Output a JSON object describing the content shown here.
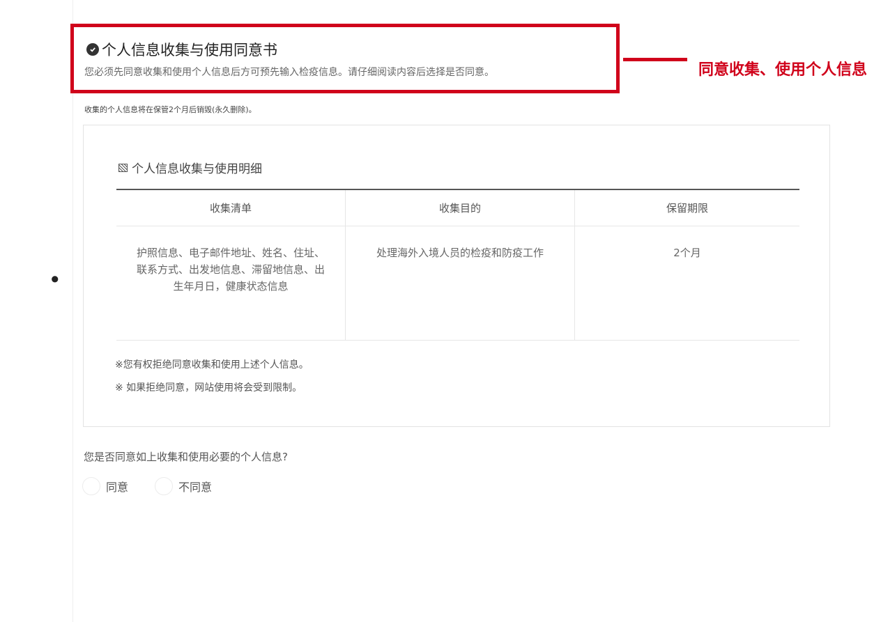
{
  "header": {
    "title": "个人信息收集与使用同意书",
    "subtitle": "您必须先同意收集和使用个人信息后方可预先输入检疫信息。请仔细阅读内容后选择是否同意。",
    "callout": "同意收集、使用个人信息"
  },
  "retention_note": "收集的个人信息将在保管2个月后销毁(永久删除)。",
  "details": {
    "section_title": "个人信息收集与使用明细",
    "table": {
      "headers": [
        "收集清单",
        "收集目的",
        "保留期限"
      ],
      "rows": [
        [
          "护照信息、电子邮件地址、姓名、住址、联系方式、出发地信息、滞留地信息、出生年月日，健康状态信息",
          "处理海外入境人员的检疫和防疫工作",
          "2个月"
        ]
      ]
    },
    "notes": [
      "※您有权拒绝同意收集和使用上述个人信息。",
      "※ 如果拒绝同意，网站使用将会受到限制。"
    ]
  },
  "consent": {
    "question": "您是否同意如上收集和使用必要的个人信息?",
    "options": [
      "同意",
      "不同意"
    ]
  },
  "colors": {
    "accent": "#d0021b",
    "text": "#333333"
  },
  "icons": {
    "title_icon": "check-circle-icon",
    "section_icon": "hatched-square-icon"
  }
}
